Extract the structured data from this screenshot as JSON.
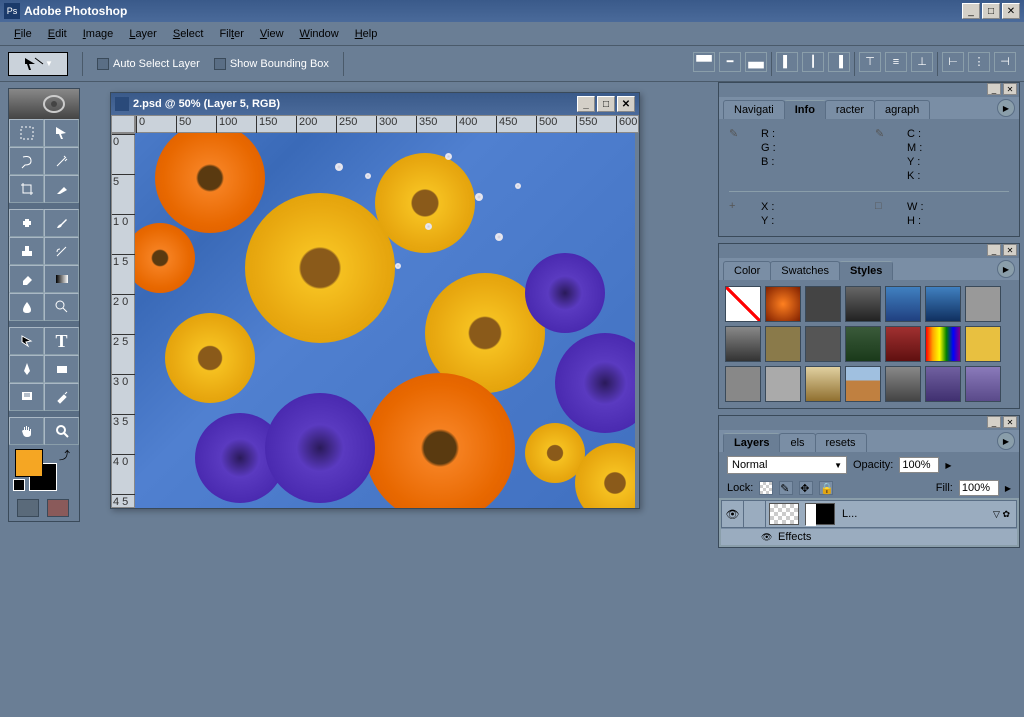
{
  "app": {
    "title": "Adobe Photoshop"
  },
  "window_controls": {
    "minimize": "_",
    "maximize": "□",
    "close": "✕"
  },
  "menu": [
    "File",
    "Edit",
    "Image",
    "Layer",
    "Select",
    "Filter",
    "View",
    "Window",
    "Help"
  ],
  "options": {
    "auto_select_label": "Auto Select Layer",
    "show_bbox_label": "Show Bounding Box"
  },
  "document": {
    "title": "2.psd @ 50% (Layer 5, RGB)",
    "ruler_h": [
      "0",
      "50",
      "100",
      "150",
      "200",
      "250",
      "300",
      "350",
      "400",
      "450",
      "500",
      "550",
      "600"
    ],
    "ruler_v": [
      "0",
      "5",
      "1 0",
      "1 5",
      "2 0",
      "2 5",
      "3 0",
      "3 5",
      "4 0",
      "4 5"
    ]
  },
  "info_panel": {
    "tabs": [
      "Navigati",
      "Info",
      "racter",
      "agraph"
    ],
    "left1": [
      "R :",
      "G :",
      "B :"
    ],
    "right1": [
      "C :",
      "M :",
      "Y :",
      "K :"
    ],
    "left2": [
      "X :",
      "Y :"
    ],
    "right2": [
      "W :",
      "H :"
    ]
  },
  "styles_panel": {
    "tabs": [
      "Color",
      "Swatches",
      "Styles"
    ]
  },
  "layers_panel": {
    "tabs": [
      "Layers",
      "els",
      "resets"
    ],
    "blend_mode": "Normal",
    "opacity_label": "Opacity:",
    "opacity_value": "100%",
    "lock_label": "Lock:",
    "fill_label": "Fill:",
    "fill_value": "100%",
    "layer_name": "L...",
    "effects_label": "Effects"
  }
}
